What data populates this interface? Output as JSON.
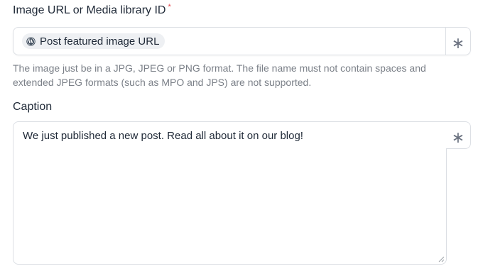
{
  "image_field": {
    "label": "Image URL or Media library ID",
    "required_mark": "*",
    "chip_label": "Post featured image URL",
    "chip_icon": "wordpress-icon",
    "side_button_glyph": "∗",
    "help_text": "The image just be in a JPG, JPEG or PNG format. The file name must not contain spaces and extended JPEG formats (such as MPO and JPS) are not supported."
  },
  "caption_field": {
    "label": "Caption",
    "value": "We just published a new post. Read all about it on our blog!",
    "side_button_glyph": "∗"
  },
  "colors": {
    "required": "#e5484d",
    "border": "#dcdfe4",
    "chip_bg": "#eef0f3",
    "help_text": "#7b8088"
  }
}
